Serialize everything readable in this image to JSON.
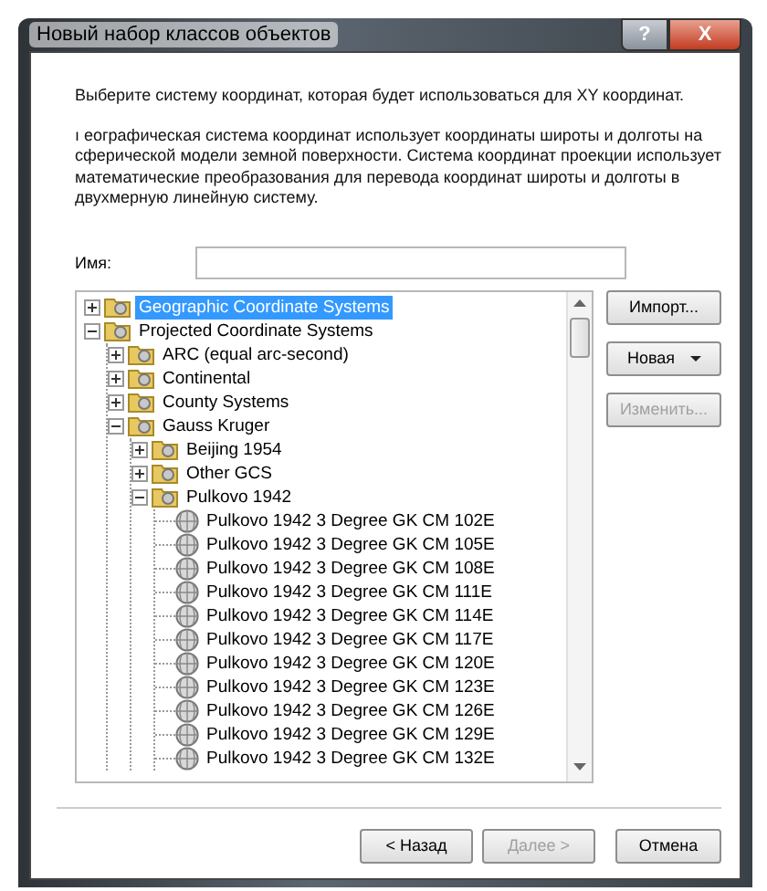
{
  "window": {
    "title": "Новый набор классов объектов",
    "buttons": [
      "?",
      "X"
    ]
  },
  "intro": "Выберите систему координат, которая будет использоваться для XY координат.",
  "description": "ı еографическая система координат использует координаты широты и долготы на сферической модели земной поверхности. Система координат проекции использует математические преобразования для перевода координат широты и долготы в двухмерную линейную систему.",
  "name_field": {
    "label": "Имя:"
  },
  "tree": [
    {
      "label": "Geographic Coordinate Systems",
      "kind": "folder",
      "expanded": false,
      "selected": true
    },
    {
      "label": "Projected Coordinate Systems",
      "kind": "folder",
      "expanded": true,
      "selected": false,
      "children": [
        {
          "label": "ARC (equal arc-second)",
          "kind": "folder",
          "expanded": false,
          "selected": false
        },
        {
          "label": "Continental",
          "kind": "folder",
          "expanded": false,
          "selected": false
        },
        {
          "label": "County Systems",
          "kind": "folder",
          "expanded": false,
          "selected": false
        },
        {
          "label": "Gauss Kruger",
          "kind": "folder",
          "expanded": true,
          "selected": false,
          "children": [
            {
              "label": "Beijing 1954",
              "kind": "folder",
              "expanded": false,
              "selected": false
            },
            {
              "label": "Other GCS",
              "kind": "folder",
              "expanded": false,
              "selected": false
            },
            {
              "label": "Pulkovo 1942",
              "kind": "folder",
              "expanded": true,
              "selected": false,
              "children": [
                {
                  "label": "Pulkovo 1942 3 Degree GK CM 102E",
                  "kind": "globe",
                  "selected": false
                },
                {
                  "label": "Pulkovo 1942 3 Degree GK CM 105E",
                  "kind": "globe",
                  "selected": false
                },
                {
                  "label": "Pulkovo 1942 3 Degree GK CM 108E",
                  "kind": "globe",
                  "selected": false
                },
                {
                  "label": "Pulkovo 1942 3 Degree GK CM 111E",
                  "kind": "globe",
                  "selected": false
                },
                {
                  "label": "Pulkovo 1942 3 Degree GK CM 114E",
                  "kind": "globe",
                  "selected": false
                },
                {
                  "label": "Pulkovo 1942 3 Degree GK CM 117E",
                  "kind": "globe",
                  "selected": false
                },
                {
                  "label": "Pulkovo 1942 3 Degree GK CM 120E",
                  "kind": "globe",
                  "selected": false
                },
                {
                  "label": "Pulkovo 1942 3 Degree GK CM 123E",
                  "kind": "globe",
                  "selected": false
                },
                {
                  "label": "Pulkovo 1942 3 Degree GK CM 126E",
                  "kind": "globe",
                  "selected": false
                },
                {
                  "label": "Pulkovo 1942 3 Degree GK CM 129E",
                  "kind": "globe",
                  "selected": false
                },
                {
                  "label": "Pulkovo 1942 3 Degree GK CM 132E",
                  "kind": "globe",
                  "selected": false
                }
              ]
            }
          ]
        }
      ]
    }
  ],
  "side_buttons": [
    {
      "label": "Импорт...",
      "disabled": false,
      "dropdown": false
    },
    {
      "label": "Новая",
      "disabled": false,
      "dropdown": true
    },
    {
      "label": "Изменить...",
      "disabled": true,
      "dropdown": false
    }
  ],
  "footer_buttons": [
    {
      "label": "< Назад",
      "disabled": false
    },
    {
      "label": "Далее >",
      "disabled": true
    },
    {
      "label": "Отмена",
      "disabled": false
    }
  ]
}
